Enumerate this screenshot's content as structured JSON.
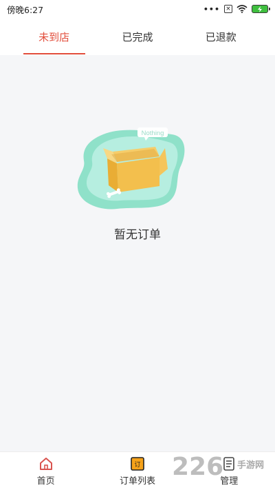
{
  "status": {
    "time": "傍晚6:27"
  },
  "tabs": [
    {
      "label": "未到店",
      "active": true
    },
    {
      "label": "已完成",
      "active": false
    },
    {
      "label": "已退款",
      "active": false
    }
  ],
  "empty": {
    "badge": "Nothing",
    "message": "暂无订单"
  },
  "nav": {
    "home": "首页",
    "orders": "订单列表",
    "manage": "管理"
  },
  "watermark": {
    "brand": "226",
    "sub": "手游网"
  }
}
